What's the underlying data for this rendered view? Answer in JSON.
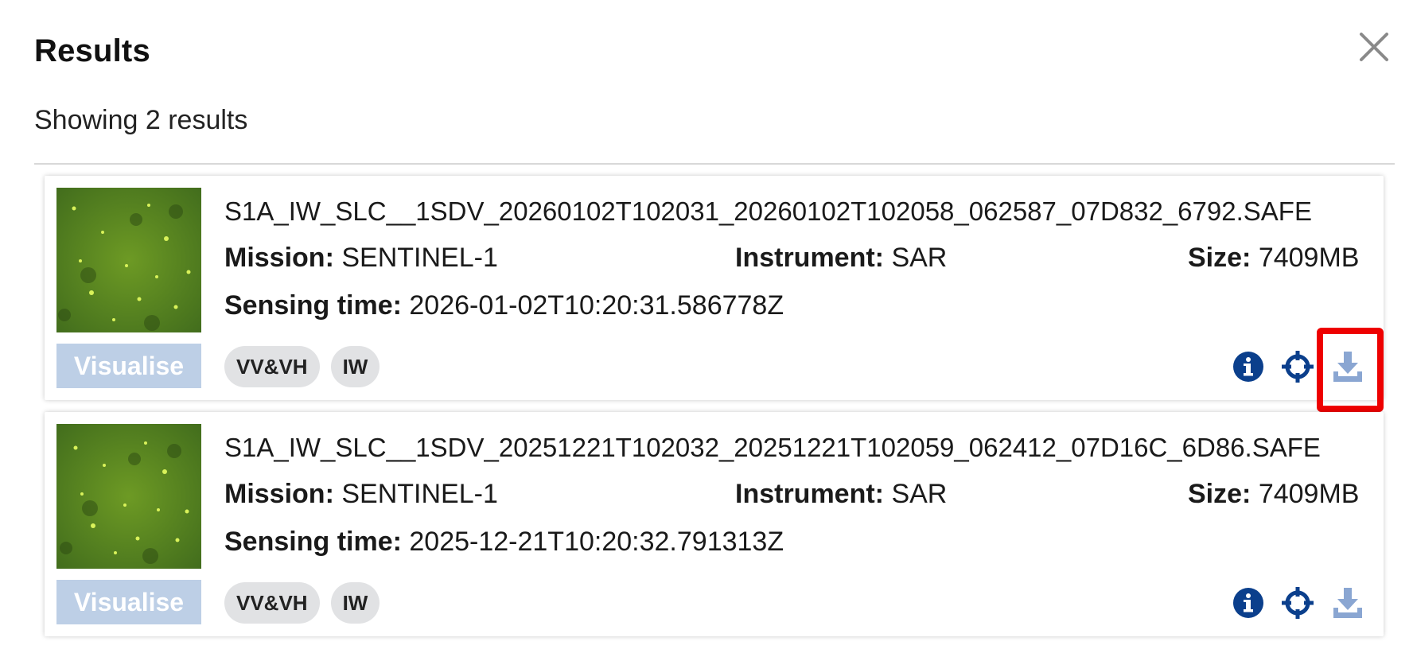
{
  "header": {
    "title": "Results",
    "close_icon": "close-icon"
  },
  "summary": "Showing 2 results",
  "labels": {
    "mission": "Mission:",
    "instrument": "Instrument:",
    "size": "Size:",
    "sensing_time": "Sensing time:"
  },
  "colors": {
    "accent": "#0b3f8c",
    "visualise_disabled": "#bdcfe6",
    "download_icon": "#8aa6d2",
    "highlight": "#ee0000"
  },
  "results": [
    {
      "filename": "S1A_IW_SLC__1SDV_20260102T102031_20260102T102058_062587_07D832_6792.SAFE",
      "mission": "SENTINEL-1",
      "instrument": "SAR",
      "size": "7409MB",
      "sensing_time": "2026-01-02T10:20:31.586778Z",
      "visualise_label": "Visualise",
      "tags": [
        "VV&VH",
        "IW"
      ],
      "actions": [
        "info-icon",
        "crosshair-icon",
        "download-icon"
      ]
    },
    {
      "filename": "S1A_IW_SLC__1SDV_20251221T102032_20251221T102059_062412_07D16C_6D86.SAFE",
      "mission": "SENTINEL-1",
      "instrument": "SAR",
      "size": "7409MB",
      "sensing_time": "2025-12-21T10:20:32.791313Z",
      "visualise_label": "Visualise",
      "tags": [
        "VV&VH",
        "IW"
      ],
      "actions": [
        "info-icon",
        "crosshair-icon",
        "download-icon"
      ]
    }
  ]
}
